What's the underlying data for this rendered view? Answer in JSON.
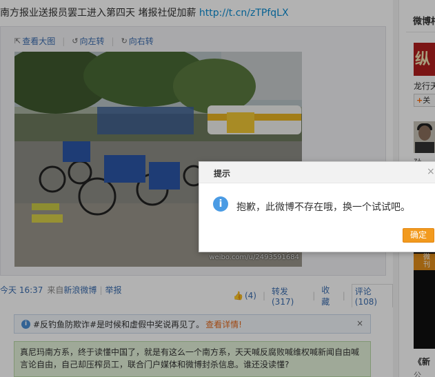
{
  "post": {
    "text": "南方报业送报员罢工进入第四天 堵报社促加薪 ",
    "link": "http://t.cn/zTPfqLX"
  },
  "media": {
    "view_large": "查看大图",
    "rotate_left": "向左转",
    "rotate_right": "向右转",
    "watermark_line1": "weibo.com/lightinyou",
    "watermark_line2": "weibo.com/u/2493591684"
  },
  "meta": {
    "time": "今天 16:37",
    "from": "来自",
    "source": "新浪微博",
    "report": "举报",
    "likes": "(4)",
    "repost": "转发(317)",
    "favorite": "收藏",
    "comment": "评论(108)"
  },
  "tip": {
    "text": "#反钓鱼防欺诈#是时候和虚假中奖说再见了。",
    "detail": "查看详情!",
    "close": "×"
  },
  "comment_text": "真尼玛南方系，终于读懂中国了，就是有这么一个南方系，天天喊反腐败喊维权喊新闻自由喊言论自由，自己却压榨员工，联合门户媒体和微博封杀信息。谁还没读懂?",
  "sidebar": {
    "title": "微博相",
    "name1": "龙行天",
    "follow": "关",
    "name2": "孙",
    "book_title": "《新",
    "book_sub": "公"
  },
  "dialog": {
    "title": "提示",
    "message": "抱歉，此微博不存在哦，换一个试试吧。",
    "ok": "确定",
    "close": "×"
  },
  "colors": {
    "link": "#3b6eb0",
    "accent_orange": "#f29a1e",
    "info_blue": "#4a9be4"
  }
}
